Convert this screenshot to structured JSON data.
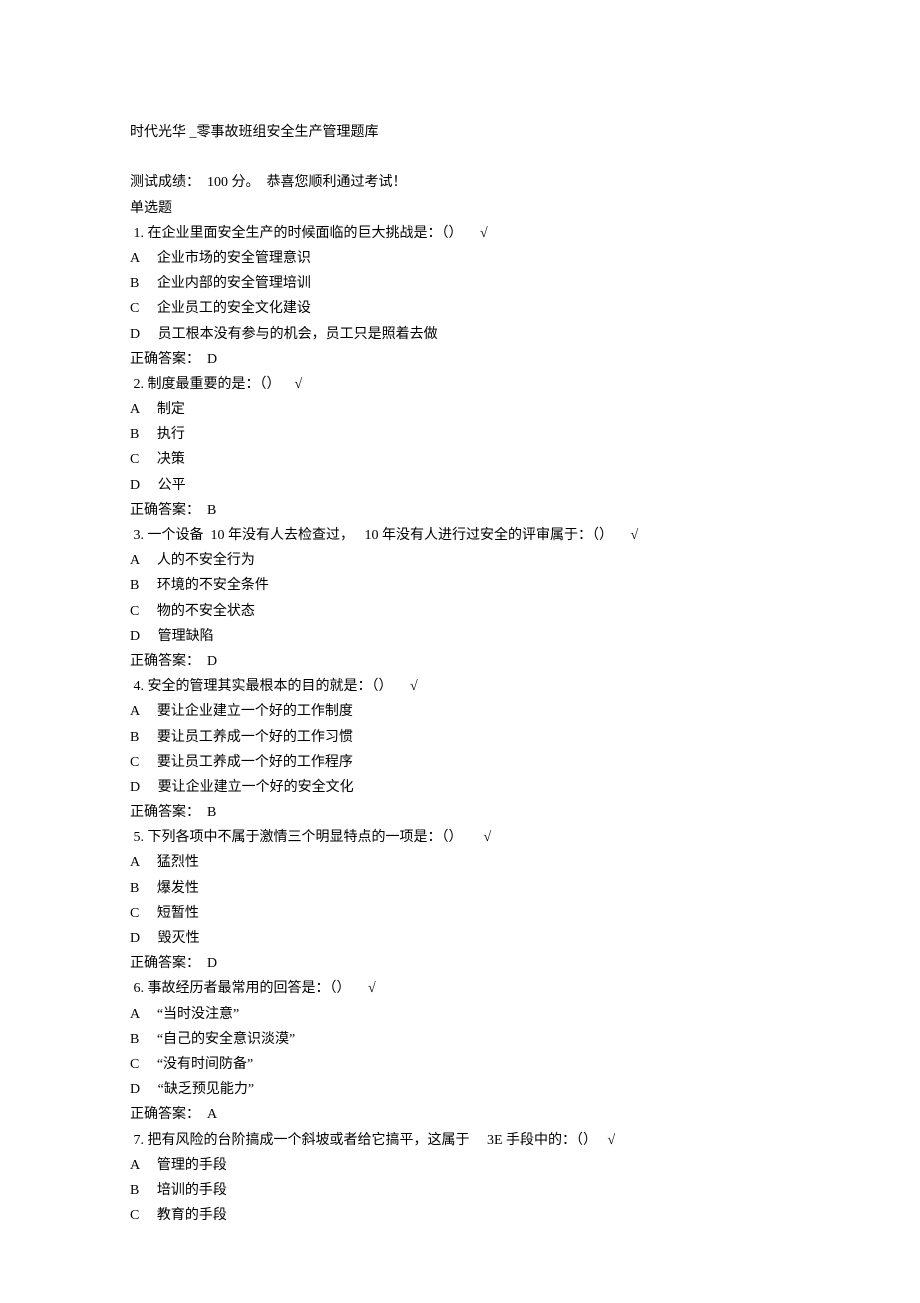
{
  "doc_title": "时代光华 _零事故班组安全生产管理题库",
  "score_line": "测试成绩：  100 分。  恭喜您顺利通过考试！",
  "section_title": "单选题",
  "questions": [
    {
      "num": "1.",
      "text": "在企业里面安全生产的时候面临的巨大挑战是：（）     √",
      "options": [
        {
          "letter": "A",
          "text": "企业市场的安全管理意识"
        },
        {
          "letter": "B",
          "text": "企业内部的安全管理培训"
        },
        {
          "letter": "C",
          "text": "企业员工的安全文化建设"
        },
        {
          "letter": "D",
          "text": "员工根本没有参与的机会，员工只是照着去做"
        }
      ],
      "answer": "正确答案：  D"
    },
    {
      "num": "2.",
      "text": "制度最重要的是：（）    √",
      "options": [
        {
          "letter": "A",
          "text": "制定"
        },
        {
          "letter": "B",
          "text": "执行"
        },
        {
          "letter": "C",
          "text": "决策"
        },
        {
          "letter": "D",
          "text": "公平"
        }
      ],
      "answer": "正确答案：  B"
    },
    {
      "num": "3.",
      "text": "一个设备  10 年没有人去检查过，   10 年没有人进行过安全的评审属于：（）     √",
      "options": [
        {
          "letter": "A",
          "text": "人的不安全行为"
        },
        {
          "letter": "B",
          "text": "环境的不安全条件"
        },
        {
          "letter": "C",
          "text": "物的不安全状态"
        },
        {
          "letter": "D",
          "text": "管理缺陷"
        }
      ],
      "answer": "正确答案：  D"
    },
    {
      "num": "4.",
      "text": "安全的管理其实最根本的目的就是：（）     √",
      "options": [
        {
          "letter": "A",
          "text": "要让企业建立一个好的工作制度"
        },
        {
          "letter": "B",
          "text": "要让员工养成一个好的工作习惯"
        },
        {
          "letter": "C",
          "text": "要让员工养成一个好的工作程序"
        },
        {
          "letter": "D",
          "text": "要让企业建立一个好的安全文化"
        }
      ],
      "answer": "正确答案：  B"
    },
    {
      "num": "5.",
      "text": "下列各项中不属于激情三个明显特点的一项是：（）      √",
      "options": [
        {
          "letter": "A",
          "text": "猛烈性"
        },
        {
          "letter": "B",
          "text": "爆发性"
        },
        {
          "letter": "C",
          "text": "短暂性"
        },
        {
          "letter": "D",
          "text": "毁灭性"
        }
      ],
      "answer": "正确答案：  D"
    },
    {
      "num": "6.",
      "text": "事故经历者最常用的回答是：（）     √",
      "options": [
        {
          "letter": "A",
          "text": "“当时没注意”"
        },
        {
          "letter": "B",
          "text": "“自己的安全意识淡漠”"
        },
        {
          "letter": "C",
          "text": "“没有时间防备”"
        },
        {
          "letter": "D",
          "text": "“缺乏预见能力”"
        }
      ],
      "answer": "正确答案：  A"
    },
    {
      "num": "7.",
      "text": "把有风险的台阶搞成一个斜坡或者给它搞平，这属于     3E 手段中的：（）   √",
      "options": [
        {
          "letter": "A",
          "text": "管理的手段"
        },
        {
          "letter": "B",
          "text": "培训的手段"
        },
        {
          "letter": "C",
          "text": "教育的手段"
        }
      ],
      "answer": ""
    }
  ]
}
